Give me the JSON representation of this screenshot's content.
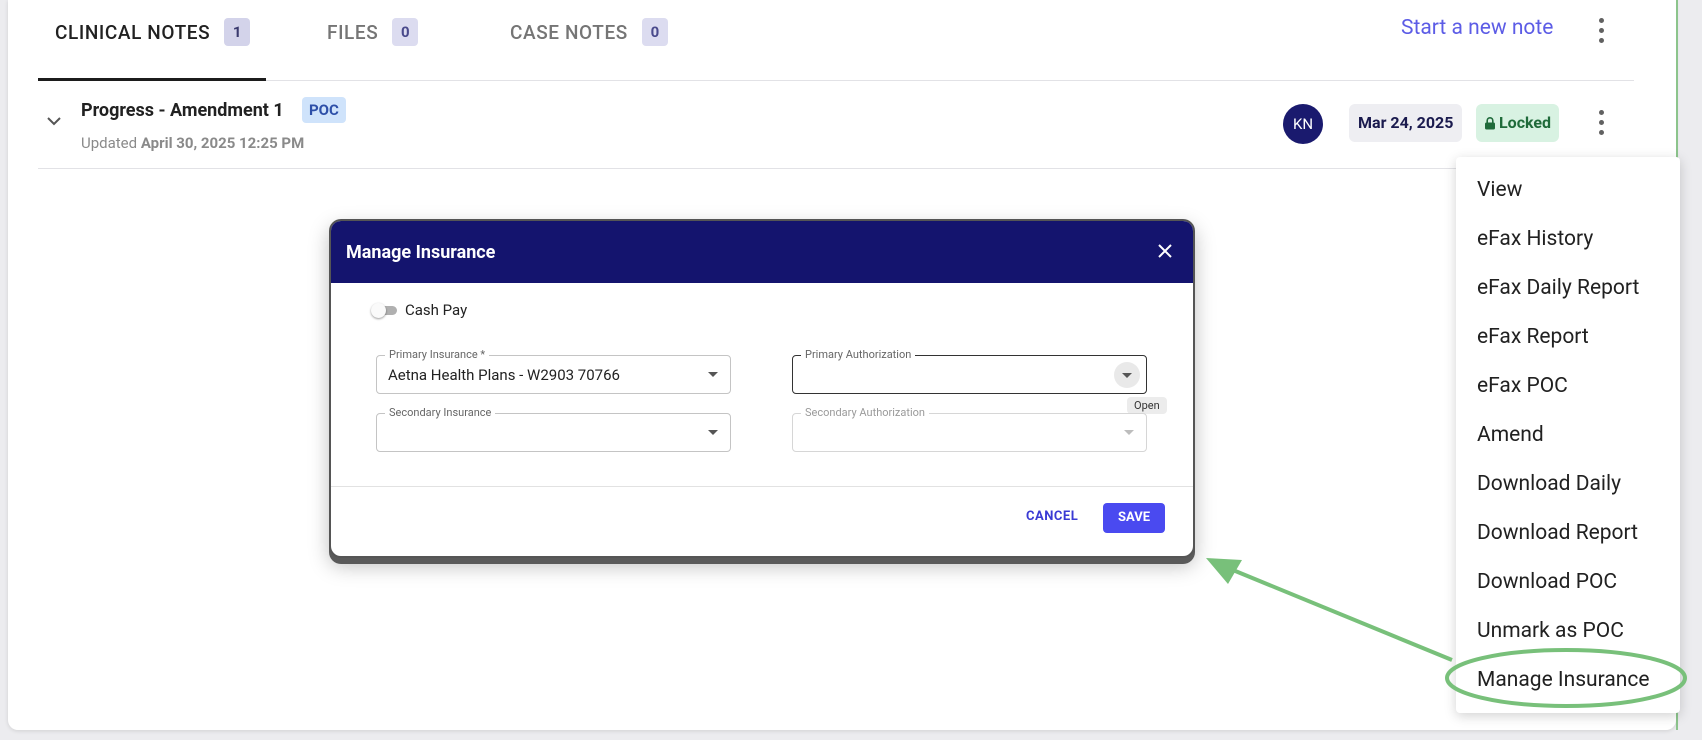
{
  "tabs": [
    {
      "label": "CLINICAL NOTES",
      "count": "1"
    },
    {
      "label": "FILES",
      "count": "0"
    },
    {
      "label": "CASE NOTES",
      "count": "0"
    }
  ],
  "header": {
    "start_note": "Start a new note"
  },
  "note": {
    "title": "Progress - Amendment 1",
    "tag": "POC",
    "updated_prefix": "Updated",
    "updated_value": "April 30, 2025 12:25 PM",
    "avatar": "KN",
    "date": "Mar 24, 2025",
    "status": "Locked"
  },
  "dialog": {
    "title": "Manage Insurance",
    "cash_pay_label": "Cash Pay",
    "primary_insurance_label": "Primary Insurance *",
    "primary_insurance_value": "Aetna Health Plans - W2903 70766",
    "primary_authorization_label": "Primary Authorization",
    "secondary_insurance_label": "Secondary Insurance",
    "secondary_authorization_label": "Secondary Authorization",
    "tooltip": "Open",
    "cancel_label": "CANCEL",
    "save_label": "SAVE"
  },
  "menu": [
    "View",
    "eFax History",
    "eFax Daily Report",
    "eFax Report",
    "eFax POC",
    "Amend",
    "Download Daily",
    "Download Report",
    "Download POC",
    "Unmark as POC",
    "Manage Insurance"
  ],
  "colors": {
    "header_navy": "#14146e",
    "accent": "#4a4af0",
    "annotation_green": "#78c07a"
  }
}
